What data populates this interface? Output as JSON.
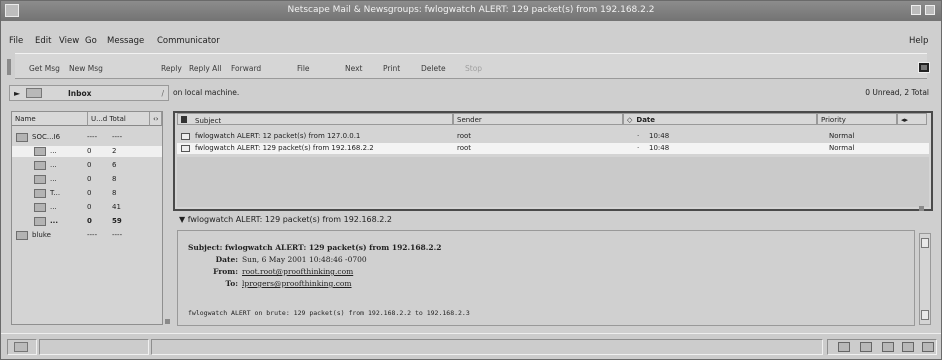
{
  "window": {
    "title": "Netscape Mail & Newsgroups: fwlogwatch ALERT: 129 packet(s) from 192.168.2.2"
  },
  "menu": {
    "items": [
      "File",
      "Edit",
      "View",
      "Go",
      "Message",
      "Communicator"
    ],
    "help": "Help"
  },
  "toolbar": {
    "get_msg": "Get Msg",
    "new_msg": "New Msg",
    "reply": "Reply",
    "reply_all": "Reply All",
    "forward": "Forward",
    "file": "File",
    "next": "Next",
    "print": "Print",
    "delete": "Delete",
    "stop": "Stop"
  },
  "location": {
    "folder": "Inbox",
    "path_text": "on local machine.",
    "unread_total": "0 Unread, 2 Total"
  },
  "folder_tree": {
    "headers": {
      "name": "Name",
      "unread_total": "U...d Total"
    },
    "rows": [
      {
        "label": "SOC...I6",
        "c1": "----",
        "c2": "----"
      },
      {
        "label": "...",
        "c1": "0",
        "c2": "2"
      },
      {
        "label": "...",
        "c1": "0",
        "c2": "6"
      },
      {
        "label": "...",
        "c1": "0",
        "c2": "8"
      },
      {
        "label": "T...",
        "c1": "0",
        "c2": "8"
      },
      {
        "label": "...",
        "c1": "0",
        "c2": "41"
      },
      {
        "label": "...",
        "c1": "0",
        "c2": "59"
      },
      {
        "label": "bluke",
        "c1": "----",
        "c2": "----"
      }
    ]
  },
  "message_list": {
    "headers": {
      "subject": "Subject",
      "sender": "Sender",
      "date": "Date",
      "priority": "Priority"
    },
    "rows": [
      {
        "subject": "fwlogwatch ALERT: 12 packet(s) from 127.0.0.1",
        "sender": "root",
        "date": "10:48",
        "priority": "Normal"
      },
      {
        "subject": "fwlogwatch ALERT: 129 packet(s) from 192.168.2.2",
        "sender": "root",
        "date": "10:48",
        "priority": "Normal"
      }
    ]
  },
  "preview": {
    "collapse_title": "fwlogwatch ALERT: 129 packet(s) from 192.168.2.2",
    "subject_label": "Subject:",
    "subject": "fwlogwatch ALERT: 129 packet(s) from 192.168.2.2",
    "date_label": "Date:",
    "date": "Sun, 6 May 2001 10:48:46 -0700",
    "from_label": "From:",
    "from": "root.root@proofthinking.com",
    "to_label": "To:",
    "to": "lprogers@proofthinking.com",
    "body": "fwlogwatch ALERT on brute: 129 packet(s) from 192.168.2.2 to 192.168.2.3"
  }
}
